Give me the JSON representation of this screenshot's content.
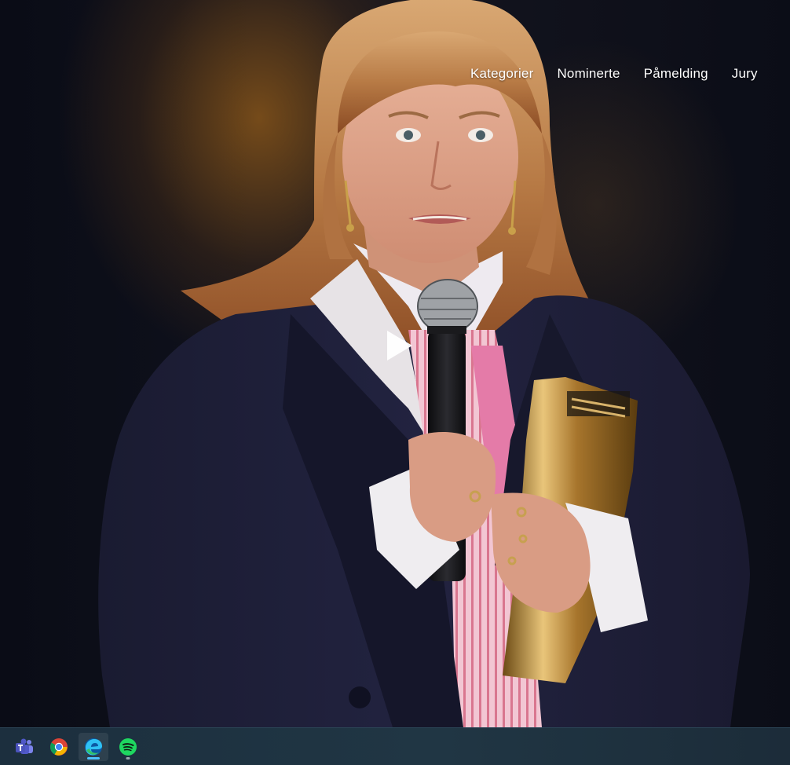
{
  "nav": {
    "items": [
      {
        "label": "Kategorier"
      },
      {
        "label": "Nominerte"
      },
      {
        "label": "Påmelding"
      },
      {
        "label": "Jury"
      }
    ]
  },
  "video": {
    "play_icon": "play-icon"
  },
  "taskbar": {
    "apps": [
      {
        "name": "Microsoft Teams",
        "icon": "teams-icon",
        "active": false
      },
      {
        "name": "Google Chrome",
        "icon": "chrome-icon",
        "active": false
      },
      {
        "name": "Microsoft Edge",
        "icon": "edge-icon",
        "active": true
      },
      {
        "name": "Spotify",
        "icon": "spotify-icon",
        "active": false
      }
    ],
    "colors": {
      "edge_indicator": "#4cc2ff",
      "inactive_indicator": "#9aa6ad"
    }
  }
}
